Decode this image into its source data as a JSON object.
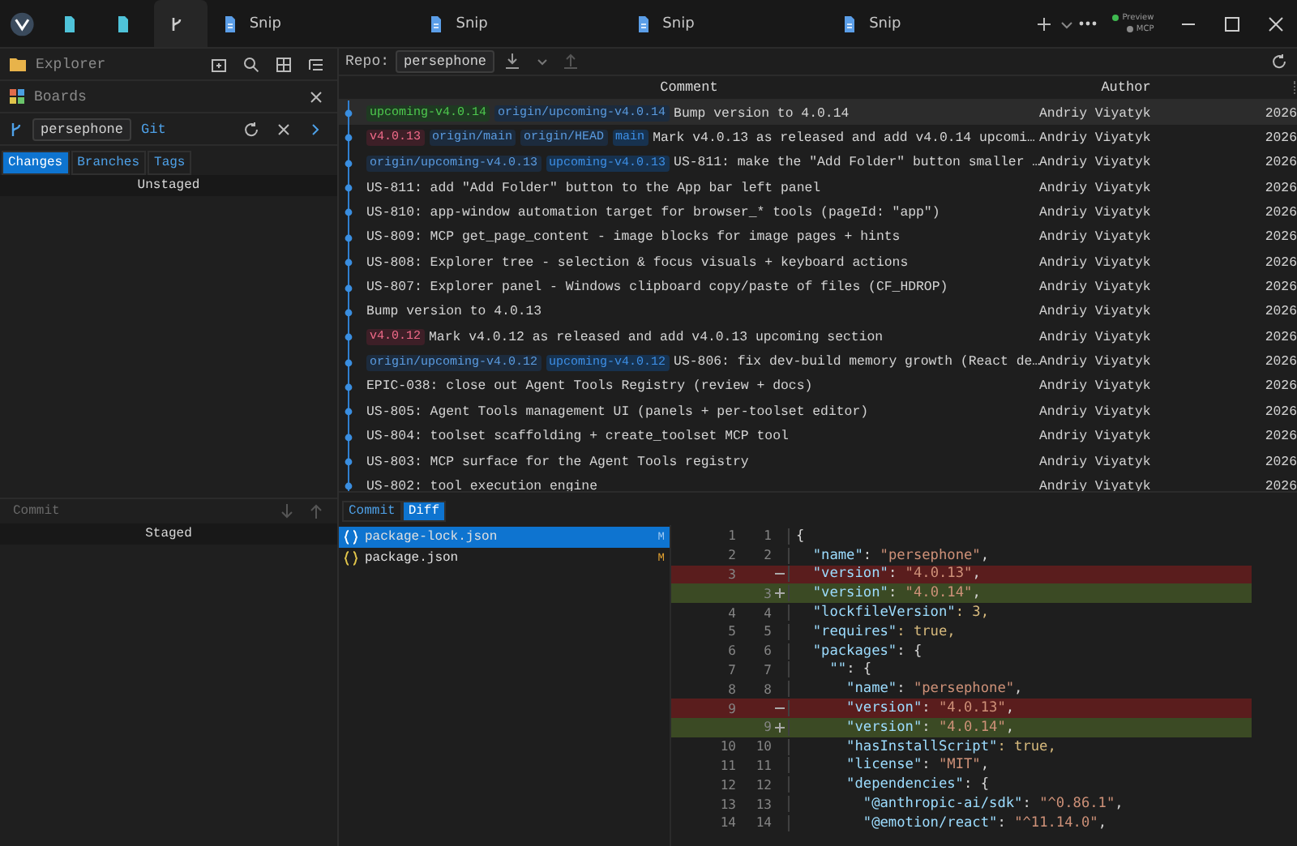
{
  "titlebar": {
    "tabs": [
      {
        "kind": "file",
        "selected": false
      },
      {
        "kind": "file",
        "selected": false
      },
      {
        "kind": "git",
        "selected": true
      },
      {
        "kind": "doc",
        "label": "Snip",
        "selected": false
      },
      {
        "kind": "doc",
        "label": "Snip",
        "selected": false
      },
      {
        "kind": "doc",
        "label": "Snip",
        "selected": false
      },
      {
        "kind": "doc",
        "label": "Snip",
        "selected": false
      }
    ],
    "status": [
      {
        "label": "Preview",
        "color": "#3fb950"
      },
      {
        "label": "MCP",
        "color": "#8a8a8a"
      }
    ]
  },
  "sidebar": {
    "title": "Explorer",
    "boards": "Boards",
    "repo": {
      "name": "persephone",
      "link": "Git"
    },
    "tabs": [
      {
        "label": "Changes",
        "selected": true
      },
      {
        "label": "Branches",
        "selected": false
      },
      {
        "label": "Tags",
        "selected": false
      }
    ],
    "unstaged": "Unstaged",
    "commit": {
      "placeholder": "Commit"
    },
    "staged": "Staged"
  },
  "main": {
    "toolbar": {
      "label": "Repo:",
      "repo": "persephone"
    },
    "table": {
      "columns": [
        "Comment",
        "Author"
      ],
      "rows": [
        {
          "selected": true,
          "refs": [
            {
              "label": "upcoming-v4.0.14",
              "kind": "head"
            },
            {
              "label": "origin/upcoming-v4.0.14",
              "kind": "remote"
            }
          ],
          "comment": "Bump version to 4.0.14",
          "author": "Andriy Viyatyk",
          "date": "2026"
        },
        {
          "selected": false,
          "refs": [
            {
              "label": "v4.0.13",
              "kind": "tag"
            },
            {
              "label": "origin/main",
              "kind": "remote"
            },
            {
              "label": "origin/HEAD",
              "kind": "remote"
            },
            {
              "label": "main",
              "kind": "branch"
            }
          ],
          "comment": "Mark v4.0.13 as released and add v4.0.14 upcomi…",
          "author": "Andriy Viyatyk",
          "date": "2026"
        },
        {
          "selected": false,
          "refs": [
            {
              "label": "origin/upcoming-v4.0.13",
              "kind": "remote"
            },
            {
              "label": "upcoming-v4.0.13",
              "kind": "branch"
            }
          ],
          "comment": "US-811: make the \"Add Folder\" button smaller …",
          "author": "Andriy Viyatyk",
          "date": "2026"
        },
        {
          "selected": false,
          "refs": [],
          "comment": "US-811: add \"Add Folder\" button to the App bar left panel",
          "author": "Andriy Viyatyk",
          "date": "2026"
        },
        {
          "selected": false,
          "refs": [],
          "comment": "US-810: app-window automation target for browser_* tools (pageId: \"app\")",
          "author": "Andriy Viyatyk",
          "date": "2026"
        },
        {
          "selected": false,
          "refs": [],
          "comment": "US-809: MCP get_page_content - image blocks for image pages + hints",
          "author": "Andriy Viyatyk",
          "date": "2026"
        },
        {
          "selected": false,
          "refs": [],
          "comment": "US-808: Explorer tree - selection & focus visuals + keyboard actions",
          "author": "Andriy Viyatyk",
          "date": "2026"
        },
        {
          "selected": false,
          "refs": [],
          "comment": "US-807: Explorer panel - Windows clipboard copy/paste of files (CF_HDROP)",
          "author": "Andriy Viyatyk",
          "date": "2026"
        },
        {
          "selected": false,
          "refs": [],
          "comment": "Bump version to 4.0.13",
          "author": "Andriy Viyatyk",
          "date": "2026"
        },
        {
          "selected": false,
          "refs": [
            {
              "label": "v4.0.12",
              "kind": "tag"
            }
          ],
          "comment": "Mark v4.0.12 as released and add v4.0.13 upcoming section",
          "author": "Andriy Viyatyk",
          "date": "2026"
        },
        {
          "selected": false,
          "refs": [
            {
              "label": "origin/upcoming-v4.0.12",
              "kind": "remote"
            },
            {
              "label": "upcoming-v4.0.12",
              "kind": "branch"
            }
          ],
          "comment": "US-806: fix dev-build memory growth (React de…",
          "author": "Andriy Viyatyk",
          "date": "2026"
        },
        {
          "selected": false,
          "refs": [],
          "comment": "EPIC-038: close out Agent Tools Registry (review + docs)",
          "author": "Andriy Viyatyk",
          "date": "2026"
        },
        {
          "selected": false,
          "refs": [],
          "comment": "US-805: Agent Tools management UI (panels + per-toolset editor)",
          "author": "Andriy Viyatyk",
          "date": "2026"
        },
        {
          "selected": false,
          "refs": [],
          "comment": "US-804: toolset scaffolding + create_toolset MCP tool",
          "author": "Andriy Viyatyk",
          "date": "2026"
        },
        {
          "selected": false,
          "refs": [],
          "comment": "US-803: MCP surface for the Agent Tools registry",
          "author": "Andriy Viyatyk",
          "date": "2026"
        },
        {
          "selected": false,
          "refs": [],
          "comment": "US-802: tool execution engine",
          "author": "Andriy Viyatyk",
          "date": "2026"
        }
      ]
    },
    "tabs": [
      {
        "label": "Commit",
        "selected": false
      },
      {
        "label": "Diff",
        "selected": true
      }
    ],
    "files": [
      {
        "name": "package-lock.json",
        "status": "M",
        "selected": true
      },
      {
        "name": "package.json",
        "status": "M",
        "selected": false
      }
    ],
    "diff": [
      {
        "kind": "same",
        "old": "1",
        "new": "1",
        "text": "{"
      },
      {
        "kind": "same",
        "old": "2",
        "new": "2",
        "text": "  \"name\": \"persephone\","
      },
      {
        "kind": "removed",
        "old": "3",
        "text": "  \"version\": \"4.0.13\","
      },
      {
        "kind": "added",
        "new": "3",
        "text": "  \"version\": \"4.0.14\","
      },
      {
        "kind": "same",
        "old": "4",
        "new": "4",
        "text": "  \"lockfileVersion\": 3,"
      },
      {
        "kind": "same",
        "old": "5",
        "new": "5",
        "text": "  \"requires\": true,"
      },
      {
        "kind": "same",
        "old": "6",
        "new": "6",
        "text": "  \"packages\": {"
      },
      {
        "kind": "same",
        "old": "7",
        "new": "7",
        "text": "    \"\": {"
      },
      {
        "kind": "same",
        "old": "8",
        "new": "8",
        "text": "      \"name\": \"persephone\","
      },
      {
        "kind": "removed",
        "old": "9",
        "text": "      \"version\": \"4.0.13\","
      },
      {
        "kind": "added",
        "new": "9",
        "text": "      \"version\": \"4.0.14\","
      },
      {
        "kind": "same",
        "old": "10",
        "new": "10",
        "text": "      \"hasInstallScript\": true,"
      },
      {
        "kind": "same",
        "old": "11",
        "new": "11",
        "text": "      \"license\": \"MIT\","
      },
      {
        "kind": "same",
        "old": "12",
        "new": "12",
        "text": "      \"dependencies\": {"
      },
      {
        "kind": "same",
        "old": "13",
        "new": "13",
        "text": "        \"@anthropic-ai/sdk\": \"^0.86.1\","
      },
      {
        "kind": "same",
        "old": "14",
        "new": "14",
        "text": "        \"@emotion/react\": \"^11.14.0\","
      }
    ]
  }
}
